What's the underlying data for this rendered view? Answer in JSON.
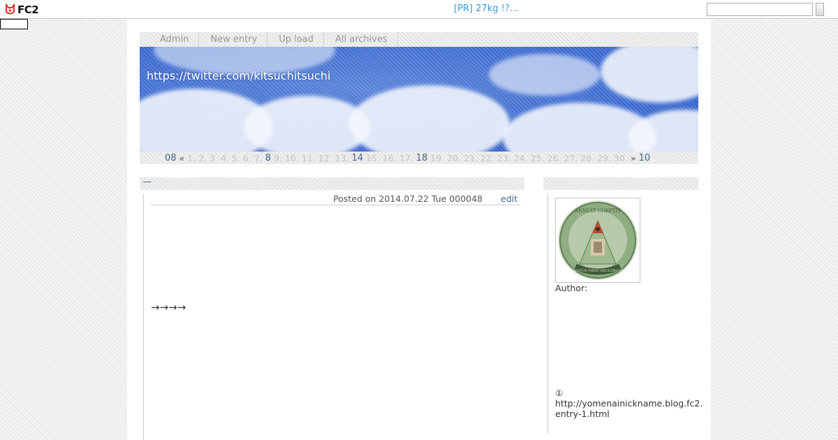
{
  "topbar": {
    "logo_text": "FC2",
    "pr_link": "[PR] 27kg !?...",
    "search_value": "",
    "colors": {
      "pr_link": "#3a9ad9",
      "logo_red": "#e03226"
    }
  },
  "nav": {
    "items": [
      {
        "label": "Admin"
      },
      {
        "label": "New entry"
      },
      {
        "label": "Up load"
      },
      {
        "label": "All archives"
      }
    ]
  },
  "banner": {
    "link_text": "https://twitter.com/kitsuchitsuchi"
  },
  "calendar": {
    "prev_month": "08",
    "prev_arrow": "«",
    "next_arrow": "»",
    "next_month": "10",
    "days": [
      {
        "label": "1.",
        "active": false
      },
      {
        "label": "2.",
        "active": false
      },
      {
        "label": "3.",
        "active": false
      },
      {
        "label": "4.",
        "active": false
      },
      {
        "label": "5.",
        "active": false
      },
      {
        "label": "6.",
        "active": false
      },
      {
        "label": "7.",
        "active": false
      },
      {
        "label": "8",
        "active": true
      },
      {
        "label": "9.",
        "active": false
      },
      {
        "label": "10.",
        "active": false
      },
      {
        "label": "11.",
        "active": false
      },
      {
        "label": "12.",
        "active": false
      },
      {
        "label": "13.",
        "active": false
      },
      {
        "label": "14",
        "active": true
      },
      {
        "label": "15.",
        "active": false
      },
      {
        "label": "16.",
        "active": false
      },
      {
        "label": "17.",
        "active": false
      },
      {
        "label": "18",
        "active": true
      },
      {
        "label": "19.",
        "active": false
      },
      {
        "label": "20.",
        "active": false
      },
      {
        "label": "21.",
        "active": false
      },
      {
        "label": "22.",
        "active": false
      },
      {
        "label": "23.",
        "active": false
      },
      {
        "label": "24.",
        "active": false
      },
      {
        "label": "25.",
        "active": false
      },
      {
        "label": "26.",
        "active": false
      },
      {
        "label": "27.",
        "active": false
      },
      {
        "label": "28.",
        "active": false
      },
      {
        "label": "29.",
        "active": false
      },
      {
        "label": "30.",
        "active": false
      }
    ]
  },
  "entry": {
    "title": "—",
    "posted": "Posted on 2014.07.22 Tue 000048",
    "edit_label": "edit",
    "body_text": "→→→→"
  },
  "sidebar": {
    "author_label": "Author:",
    "note_line1": "①",
    "note_line2": "http://yomenainickname.blog.fc2.",
    "note_line3": "entry-1.html"
  },
  "avatar": {
    "seal_text_top": "ANNUIT  COEPTIS",
    "seal_text_bottom": "NOVUS ORDO SECLORUM",
    "colors": {
      "seal": "#7f9e72"
    }
  }
}
